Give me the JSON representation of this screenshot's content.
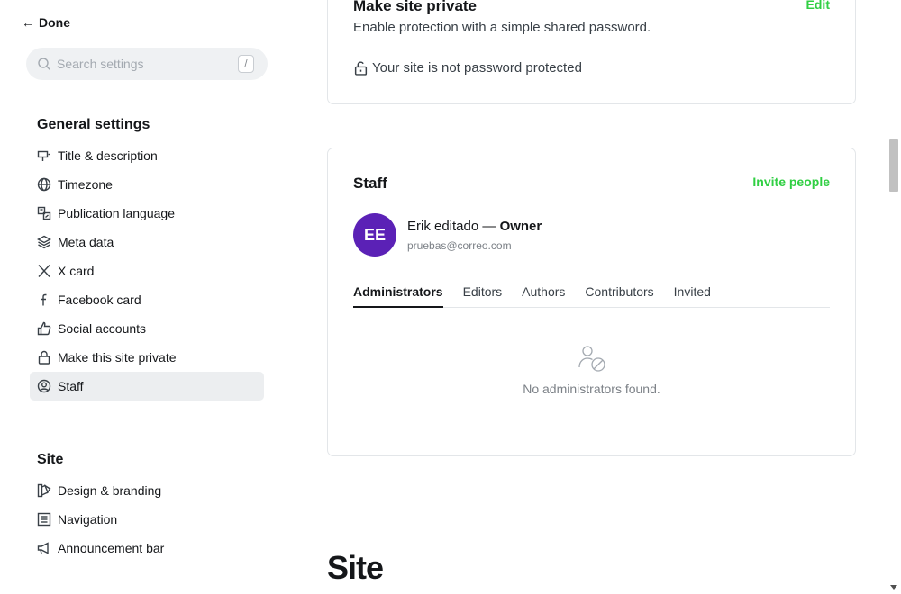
{
  "sidebar": {
    "done_label": "Done",
    "search_placeholder": "Search settings",
    "search_shortcut": "/",
    "general_heading": "General settings",
    "general_items": [
      {
        "label": "Title & description",
        "icon": "title-icon"
      },
      {
        "label": "Timezone",
        "icon": "globe-icon"
      },
      {
        "label": "Publication language",
        "icon": "translate-icon"
      },
      {
        "label": "Meta data",
        "icon": "layers-icon"
      },
      {
        "label": "X card",
        "icon": "x-logo-icon"
      },
      {
        "label": "Facebook card",
        "icon": "facebook-icon"
      },
      {
        "label": "Social accounts",
        "icon": "thumbs-up-icon"
      },
      {
        "label": "Make this site private",
        "icon": "lock-icon"
      },
      {
        "label": "Staff",
        "icon": "staff-icon",
        "active": true
      }
    ],
    "site_heading": "Site",
    "site_items": [
      {
        "label": "Design & branding",
        "icon": "brush-icon"
      },
      {
        "label": "Navigation",
        "icon": "list-icon"
      },
      {
        "label": "Announcement bar",
        "icon": "megaphone-icon"
      }
    ]
  },
  "private_card": {
    "title": "Make site private",
    "edit_label": "Edit",
    "description": "Enable protection with a simple shared password.",
    "status": "Your site is not password protected"
  },
  "staff_card": {
    "title": "Staff",
    "invite_label": "Invite people",
    "owner": {
      "initials": "EE",
      "name": "Erik editado",
      "separator": " — ",
      "role": "Owner",
      "email": "pruebas@correo.com"
    },
    "tabs": [
      "Administrators",
      "Editors",
      "Authors",
      "Contributors",
      "Invited"
    ],
    "active_tab": "Administrators",
    "empty_text": "No administrators found."
  },
  "section_heading": "Site",
  "colors": {
    "accent_green": "#30cf43",
    "avatar_purple": "#5b21b6"
  }
}
